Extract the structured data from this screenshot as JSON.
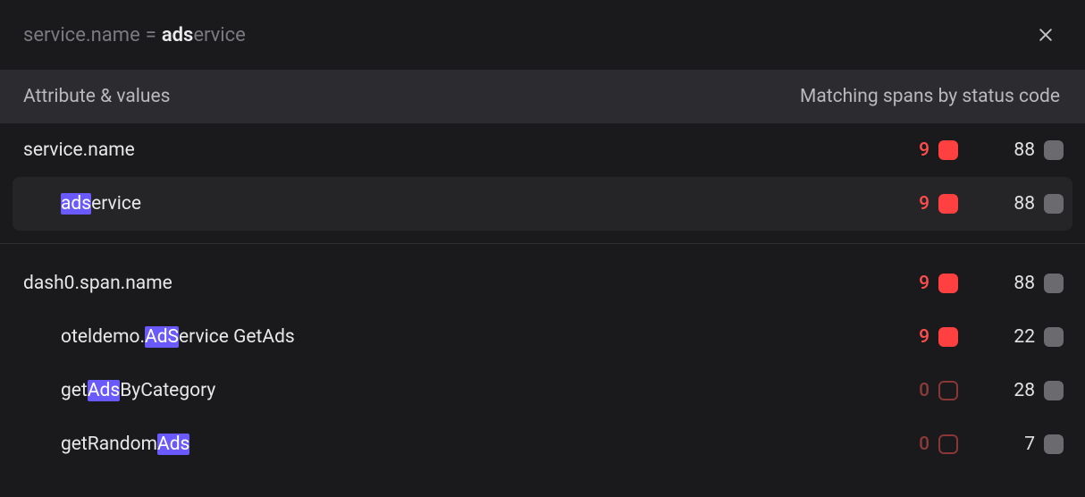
{
  "search": {
    "field": "service.name",
    "operator": "=",
    "typed": "ads",
    "completion": "ervice"
  },
  "columns": {
    "left": "Attribute & values",
    "right": "Matching spans by status code"
  },
  "groups": [
    {
      "attribute": "service.name",
      "error_count": 9,
      "error_has": true,
      "neutral_count": 88,
      "values": [
        {
          "segments": [
            {
              "t": "ads",
              "hl": true
            },
            {
              "t": "ervice",
              "hl": false
            }
          ],
          "error_count": 9,
          "error_has": true,
          "neutral_count": 88,
          "selected": true
        }
      ]
    },
    {
      "attribute": "dash0.span.name",
      "error_count": 9,
      "error_has": true,
      "neutral_count": 88,
      "values": [
        {
          "segments": [
            {
              "t": "oteldemo.",
              "hl": false
            },
            {
              "t": "AdS",
              "hl": true
            },
            {
              "t": "ervice GetAds",
              "hl": false
            }
          ],
          "error_count": 9,
          "error_has": true,
          "neutral_count": 22,
          "selected": false
        },
        {
          "segments": [
            {
              "t": "get",
              "hl": false
            },
            {
              "t": "Ads",
              "hl": true
            },
            {
              "t": "ByCategory",
              "hl": false
            }
          ],
          "error_count": 0,
          "error_has": false,
          "neutral_count": 28,
          "selected": false
        },
        {
          "segments": [
            {
              "t": "getRandom",
              "hl": false
            },
            {
              "t": "Ads",
              "hl": true
            }
          ],
          "error_count": 0,
          "error_has": false,
          "neutral_count": 7,
          "selected": false
        }
      ]
    }
  ]
}
